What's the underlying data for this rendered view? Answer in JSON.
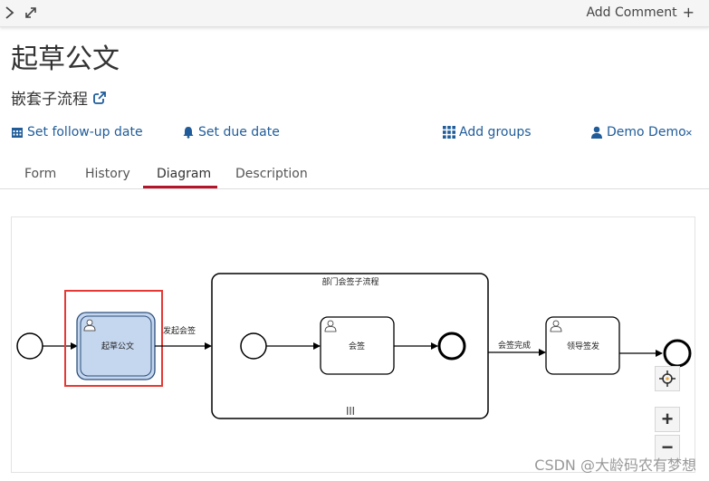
{
  "topbar": {
    "collapse_icon": "chevron-right-icon",
    "expand_icon": "expand-icon",
    "add_comment_label": "Add Comment",
    "add_comment_icon": "+"
  },
  "task": {
    "title": "起草公文",
    "process_name": "嵌套子流程"
  },
  "meta": {
    "follow_up_label": "Set follow-up date",
    "due_date_label": "Set due date",
    "add_groups_label": "Add groups",
    "assignee_label": "Demo Demo",
    "remove_assignee": "×"
  },
  "tabs": [
    {
      "label": "Form"
    },
    {
      "label": "History"
    },
    {
      "label": "Diagram",
      "active": true
    },
    {
      "label": "Description"
    }
  ],
  "diagram": {
    "tasks": {
      "draft": "起草公文",
      "countersign": "会签",
      "leader_approve": "领导签发"
    },
    "subprocess_label": "部门会签子流程",
    "multi_instance_marker": "|||",
    "flows": {
      "start_countersign": "发起会签",
      "countersign_done": "会签完成"
    },
    "highlight_color": "#e53935",
    "active_task_fill": "#c5d6ef"
  },
  "zoom": {
    "reset_icon": "crosshair-icon",
    "zoom_in": "+",
    "zoom_out": "−"
  },
  "watermark": "CSDN @大龄码农有梦想",
  "colors": {
    "link": "#1f5c99",
    "tab_active": "#b5152b"
  }
}
